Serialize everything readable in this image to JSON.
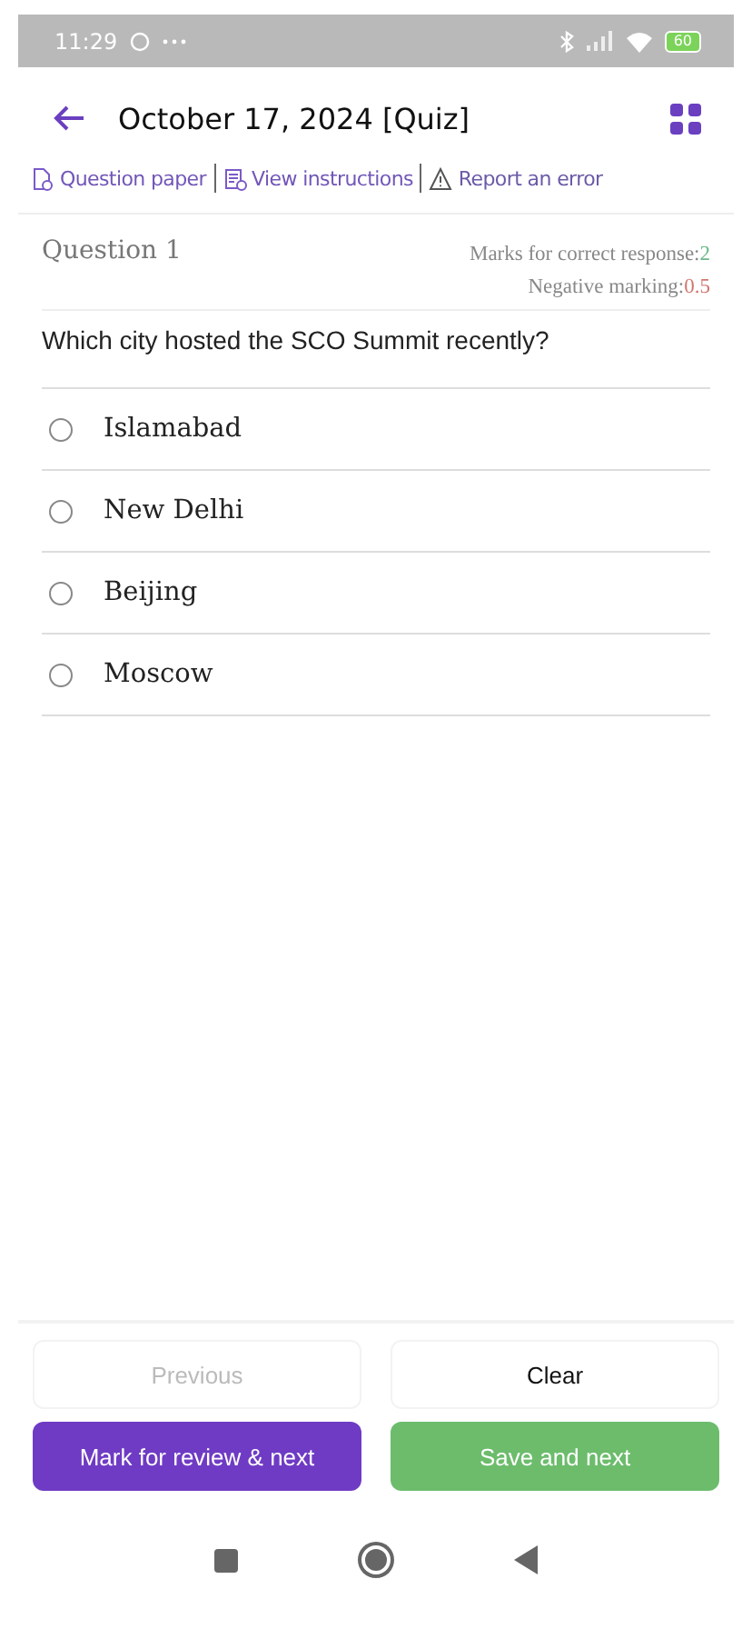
{
  "status_bar": {
    "time": "11:29",
    "battery": "60"
  },
  "header": {
    "title": "October 17, 2024 [Quiz]"
  },
  "links": [
    {
      "kind": "paper",
      "label": "Question paper"
    },
    {
      "kind": "instructions",
      "label": "View instructions"
    },
    {
      "kind": "report",
      "label": "Report an error"
    }
  ],
  "question": {
    "number": "Question 1",
    "marks_label": "Marks for correct response:",
    "marks_value": "2",
    "negative_label": "Negative marking:",
    "negative_value": "0.5",
    "text": "Which city hosted the SCO Summit recently?"
  },
  "options": [
    {
      "label": "Islamabad",
      "selected": false
    },
    {
      "label": "New Delhi",
      "selected": false
    },
    {
      "label": "Beijing",
      "selected": false
    },
    {
      "label": "Moscow",
      "selected": false
    }
  ],
  "buttons": [
    {
      "kind": "outline",
      "label": "Previous",
      "disabled": true
    },
    {
      "kind": "outline",
      "label": "Clear",
      "disabled": false
    },
    {
      "kind": "review",
      "label": "Mark for review & next",
      "disabled": false
    },
    {
      "kind": "save",
      "label": "Save and next",
      "disabled": false
    }
  ]
}
